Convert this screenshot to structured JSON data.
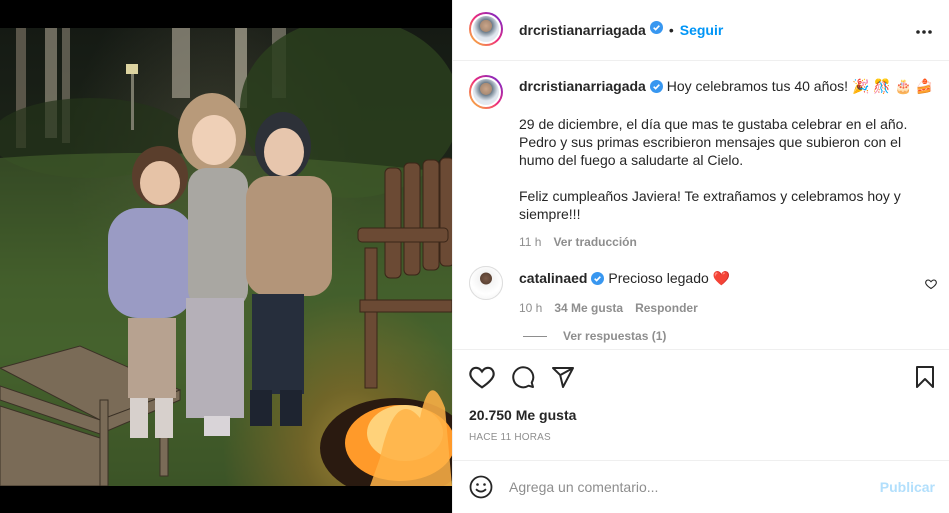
{
  "header": {
    "username": "drcristianarriagada",
    "separator": "•",
    "follow_label": "Seguir",
    "more_icon": "more-horizontal-icon"
  },
  "caption": {
    "username": "drcristianarriagada",
    "line1": "Hoy celebramos tus 40 años! 🎉 🎊 🎂 🍰",
    "para2": "29 de diciembre, el día que mas te gustaba celebrar en el año. Pedro y sus primas escribieron mensajes que subieron con el humo del fuego a saludarte al Cielo.",
    "para3": "Feliz cumpleaños Javiera! Te extrañamos y celebramos hoy y siempre!!!",
    "time": "11 h",
    "translate_label": "Ver traducción"
  },
  "comment": {
    "username": "catalinaed",
    "text": "Precioso legado",
    "emoji": "❤️",
    "time": "10 h",
    "likes": "34 Me gusta",
    "reply_label": "Responder",
    "view_replies": "Ver respuestas (1)"
  },
  "actions": {
    "likes_count": "20.750 Me gusta",
    "time_ago": "Hace 11 horas",
    "icons": [
      "heart-icon",
      "comment-icon",
      "share-icon",
      "bookmark-icon"
    ]
  },
  "add_comment": {
    "placeholder": "Agrega un comentario...",
    "publish_label": "Publicar"
  },
  "colors": {
    "accent": "#0095f6",
    "verified": "#3897f0",
    "heart_red": "#ed4956",
    "muted": "#8e8e8e",
    "text": "#262626",
    "publish_disabled": "#b2dffc"
  }
}
